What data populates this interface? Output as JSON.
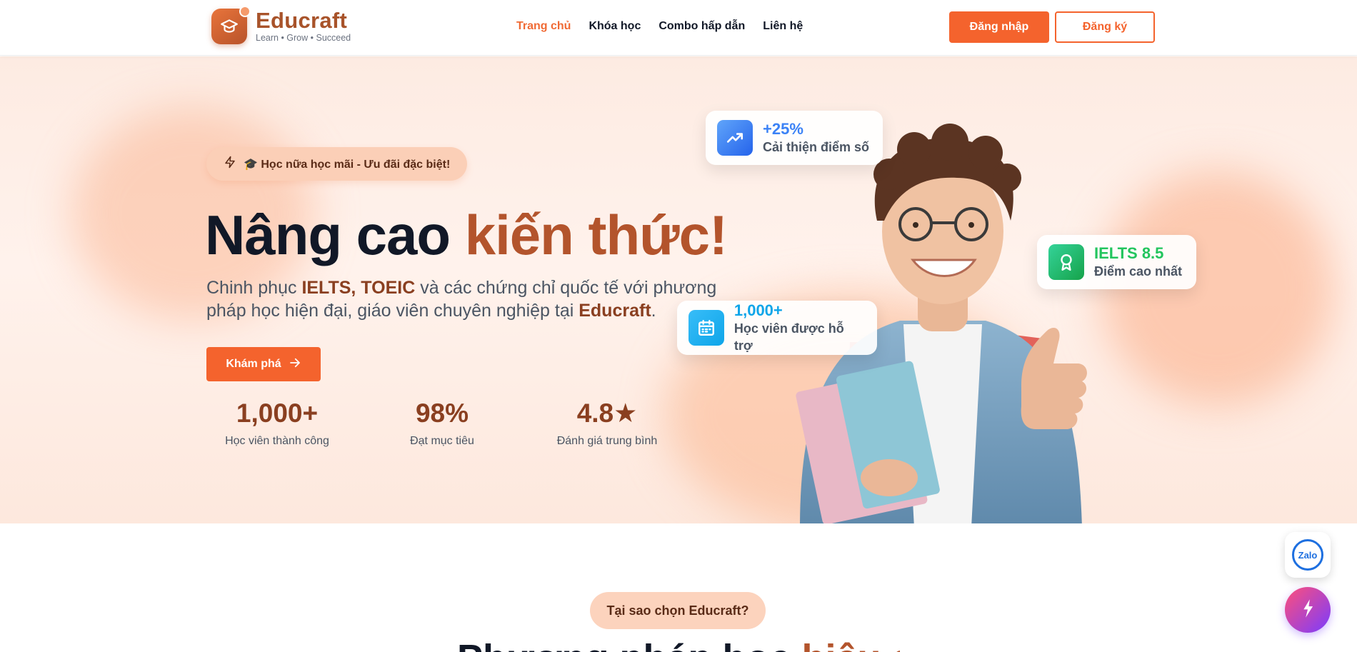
{
  "brand": {
    "name": "Educraft",
    "tagline": "Learn • Grow • Succeed"
  },
  "nav": {
    "items": [
      {
        "label": "Trang chủ",
        "active": true
      },
      {
        "label": "Khóa học",
        "active": false
      },
      {
        "label": "Combo hấp dẫn",
        "active": false
      },
      {
        "label": "Liên hệ",
        "active": false
      }
    ],
    "login_label": "Đăng nhập",
    "register_label": "Đăng ký"
  },
  "hero": {
    "badge": "🎓 Học nữa học mãi - Ưu đãi đặc biệt!",
    "headline_plain": "Nâng cao ",
    "headline_accent": "kiến thức!",
    "sub_1": "Chinh phục ",
    "sub_bold_1": "IELTS, TOEIC",
    "sub_2": " và các chứng chỉ quốc tế với phương pháp học hiện đại, giáo viên chuyên nghiệp tại ",
    "sub_bold_2": "Educraft",
    "sub_3": ".",
    "cta_label": "Khám phá",
    "stats": [
      {
        "value": "1,000+",
        "label": "Học viên thành công"
      },
      {
        "value": "98%",
        "label": "Đạt mục tiêu"
      },
      {
        "value": "4.8★",
        "label": "Đánh giá trung bình"
      }
    ],
    "cards": {
      "improve": {
        "value": "+25%",
        "label": "Cải thiện điểm số"
      },
      "ielts": {
        "value": "IELTS 8.5",
        "label": "Điểm cao nhất"
      },
      "students": {
        "value": "1,000+",
        "label": "Học viên được hỗ trợ"
      }
    }
  },
  "why": {
    "badge": "Tại sao chọn Educraft?"
  },
  "section_title": {
    "plain": "Phương pháp học ",
    "accent": "hiệu quả"
  },
  "floating": {
    "zalo_label": "Zalo"
  },
  "colors": {
    "primary": "#f4632d",
    "brand_brown": "#a8532a",
    "blue": "#3b82f6",
    "green": "#22c55e",
    "cyan": "#0ea5e9"
  }
}
